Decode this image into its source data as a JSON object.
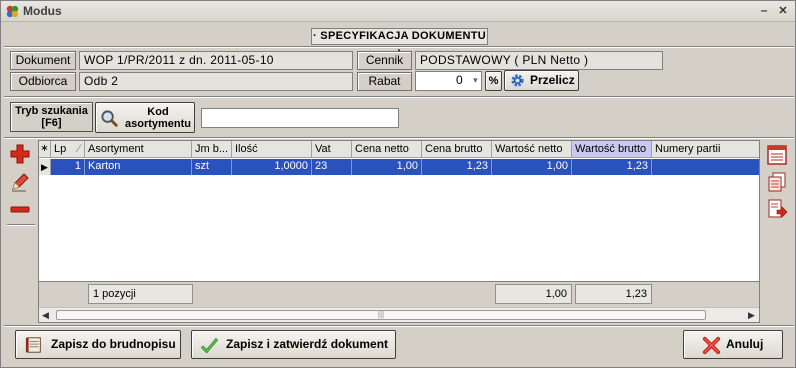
{
  "window": {
    "title": "Modus",
    "minimize": "‒",
    "close": "✕"
  },
  "header": "· SPECYFIKACJA DOKUMENTU ·",
  "fields": {
    "dokument_label": "Dokument",
    "dokument_value": "WOP 1/PR/2011 z dn. 2011-05-10",
    "odbiorca_label": "Odbiorca",
    "odbiorca_value": "Odb 2",
    "cennik_label": "Cennik",
    "cennik_value": "PODSTAWOWY ( PLN Netto )",
    "rabat_label": "Rabat",
    "rabat_value": "0",
    "percent": "%",
    "przelicz": "Przelicz"
  },
  "search": {
    "mode_label_1": "Tryb szukania",
    "mode_label_2": "[F6]",
    "code_btn_1": "Kod",
    "code_btn_2": "asortymentu",
    "input_value": ""
  },
  "table": {
    "columns": [
      "Lp",
      "Asortyment",
      "Jm b...",
      "Ilość",
      "Vat",
      "Cena netto",
      "Cena brutto",
      "Wartość netto",
      "Wartość brutto",
      "Numery partii"
    ],
    "rows": [
      {
        "lp": "1",
        "asortyment": "Karton",
        "jm": "szt",
        "ilosc": "1,0000",
        "vat": "23",
        "cena_netto": "1,00",
        "cena_brutto": "1,23",
        "wartosc_netto": "1,00",
        "wartosc_brutto": "1,23",
        "numery": ""
      }
    ],
    "footer": {
      "count": "1 pozycji",
      "sum_netto": "1,00",
      "sum_brutto": "1,23"
    },
    "sort_indicator": "∕"
  },
  "buttons": {
    "draft": "Zapisz do brudnopisu",
    "save_approve": "Zapisz i zatwierdź dokument",
    "cancel": "Anuluj"
  },
  "colors": {
    "selection": "#2a52be",
    "accent_red": "#d42a1c"
  }
}
